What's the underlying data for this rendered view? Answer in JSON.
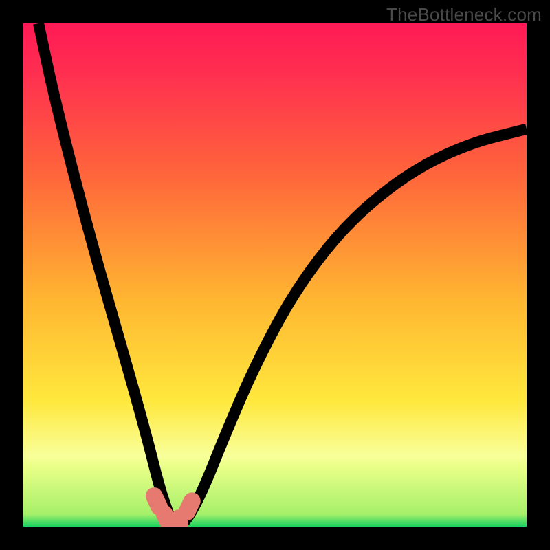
{
  "watermark": "TheBottleneck.com",
  "colors": {
    "bg": "#000000",
    "grad_top": "#ff1a55",
    "grad_mid1": "#ff653b",
    "grad_mid2": "#ffb631",
    "grad_mid3": "#ffe83d",
    "grad_band": "#f8ff9a",
    "grad_green": "#18d160",
    "curve": "#000000",
    "marker": "#e77a70"
  },
  "chart_data": {
    "type": "line",
    "title": "",
    "xlabel": "",
    "ylabel": "",
    "xrange": [
      0,
      100
    ],
    "yrange": [
      0,
      100
    ],
    "note": "Values are visual estimates of the black bottleneck V-curve read off a 0–100 normalized plot area; the curve dips to ~0 near x≈30 and rises toward both edges.",
    "series": [
      {
        "name": "bottleneck-curve",
        "x": [
          3,
          6,
          10,
          14,
          18,
          22,
          25,
          27,
          29,
          30,
          31,
          33,
          36,
          40,
          46,
          54,
          64,
          76,
          88,
          100
        ],
        "y": [
          100,
          86,
          70,
          55,
          41,
          27,
          16,
          8,
          2,
          0,
          0,
          2,
          8,
          18,
          32,
          47,
          60,
          70,
          76,
          79
        ]
      }
    ],
    "markers": {
      "name": "highlight-segment",
      "note": "Salmon rounded segments near the curve trough, approx x∈[25,34], y≈0–6",
      "points": [
        {
          "x": 26.5,
          "y": 5.0
        },
        {
          "x": 28.5,
          "y": 1.5
        },
        {
          "x": 31.0,
          "y": 0.5
        },
        {
          "x": 33.0,
          "y": 4.0
        }
      ]
    },
    "background_gradient_stops": [
      {
        "pos": 0.0,
        "color": "#ff1a55"
      },
      {
        "pos": 0.1,
        "color": "#ff2f50"
      },
      {
        "pos": 0.3,
        "color": "#ff653b"
      },
      {
        "pos": 0.55,
        "color": "#ffb631"
      },
      {
        "pos": 0.75,
        "color": "#ffe83d"
      },
      {
        "pos": 0.86,
        "color": "#f8ff9a"
      },
      {
        "pos": 0.88,
        "color": "#eaff88"
      },
      {
        "pos": 0.975,
        "color": "#a6f06a"
      },
      {
        "pos": 1.0,
        "color": "#18d160"
      }
    ]
  }
}
